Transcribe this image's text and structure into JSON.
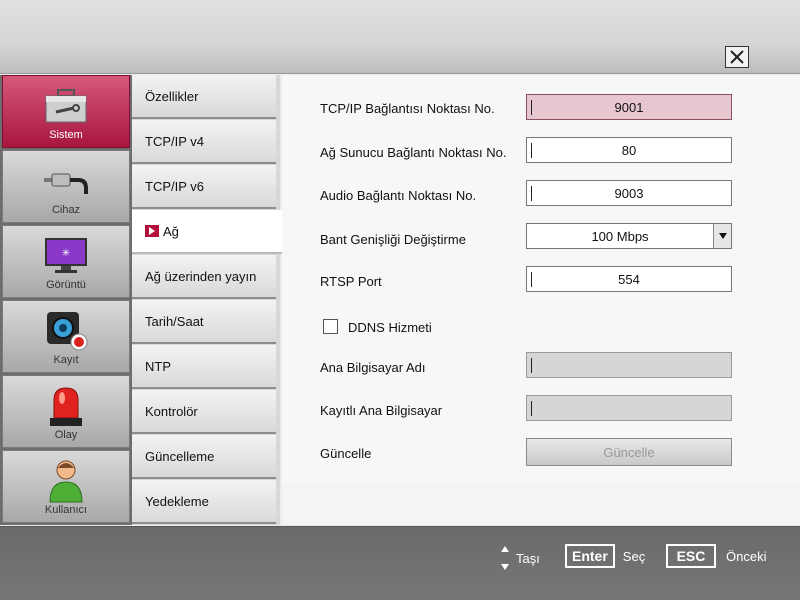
{
  "window": {
    "close_icon": "close-x-icon"
  },
  "categories": [
    {
      "label": "Sistem",
      "icon": "toolbox-icon",
      "active": true
    },
    {
      "label": "Cihaz",
      "icon": "cable-plug-icon",
      "active": false
    },
    {
      "label": "Görüntü",
      "icon": "monitor-icon",
      "active": false
    },
    {
      "label": "Kayıt",
      "icon": "camera-record-icon",
      "active": false
    },
    {
      "label": "Olay",
      "icon": "alarm-siren-icon",
      "active": false
    },
    {
      "label": "Kullanıcı",
      "icon": "user-icon",
      "active": false
    }
  ],
  "submenu": [
    {
      "label": "Özellikler"
    },
    {
      "label": "TCP/IP v4"
    },
    {
      "label": "TCP/IP v6"
    },
    {
      "label": "Ağ",
      "active": true
    },
    {
      "label": "Ağ üzerinden yayın"
    },
    {
      "label": "Tarih/Saat"
    },
    {
      "label": "NTP"
    },
    {
      "label": "Kontrolör"
    },
    {
      "label": "Güncelleme"
    },
    {
      "label": "Yedekleme"
    }
  ],
  "form": {
    "tcpip_port": {
      "label": "TCP/IP Bağlantısı Noktası No.",
      "value": "9001"
    },
    "web_port": {
      "label": "Ağ Sunucu Bağlantı Noktası No.",
      "value": "80"
    },
    "audio_port": {
      "label": "Audio Bağlantı Noktası No.",
      "value": "9003"
    },
    "bandwidth": {
      "label": "Bant Genişliği Değiştirme",
      "value": "100 Mbps"
    },
    "rtsp_port": {
      "label": "RTSP Port",
      "value": "554"
    },
    "ddns": {
      "label": "DDNS Hizmeti",
      "checked": false
    },
    "host_name": {
      "label": "Ana Bilgisayar Adı",
      "value": ""
    },
    "registered_host": {
      "label": "Kayıtlı Ana Bilgisayar",
      "value": ""
    },
    "update": {
      "label": "Güncelle",
      "button_label": "Güncelle"
    }
  },
  "footer": {
    "move_label": "Taşı",
    "enter_key": "Enter",
    "select_label": "Seç",
    "esc_key": "ESC",
    "back_label": "Önceki"
  }
}
